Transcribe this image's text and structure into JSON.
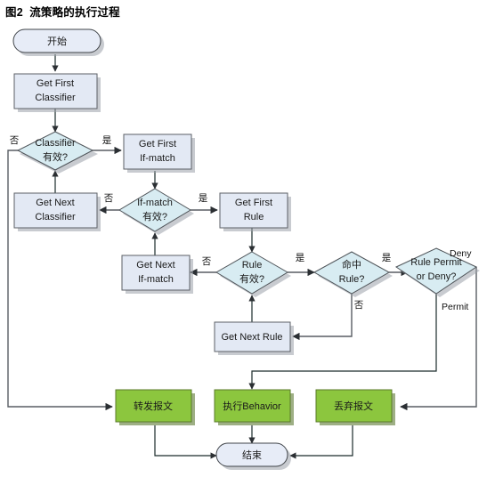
{
  "figure": {
    "title": "图2  流策略的执行过程",
    "caption_label": "图2",
    "caption_text": "流策略的执行过程"
  },
  "colors": {
    "process_fill": "#e3e9f4",
    "decision_fill": "#d8ecf2",
    "action_fill": "#8cc63e",
    "terminator_fill": "#e7ecf7",
    "line": "#595d63",
    "text": "#1a1a1a"
  },
  "nodes": {
    "start": {
      "label": "开始",
      "type": "terminator"
    },
    "get_first_classifier": {
      "label_line1": "Get First",
      "label_line2": "Classifier",
      "type": "process"
    },
    "classifier_valid": {
      "label_line1": "Classifier",
      "label_line2": "有效?",
      "type": "decision"
    },
    "get_next_classifier": {
      "label_line1": "Get Next",
      "label_line2": "Classifier",
      "type": "process"
    },
    "get_first_ifmatch": {
      "label_line1": "Get First",
      "label_line2": "If-match",
      "type": "process"
    },
    "ifmatch_valid": {
      "label_line1": "If-match",
      "label_line2": "有效?",
      "type": "decision"
    },
    "get_next_ifmatch": {
      "label_line1": "Get Next",
      "label_line2": "If-match",
      "type": "process"
    },
    "get_first_rule": {
      "label_line1": "Get First",
      "label_line2": "Rule",
      "type": "process"
    },
    "rule_valid": {
      "label_line1": "Rule",
      "label_line2": "有效?",
      "type": "decision"
    },
    "get_next_rule": {
      "label_line1": "Get Next Rule",
      "label_line2": "",
      "type": "process"
    },
    "hit_rule": {
      "label_line1": "命中",
      "label_line2": "Rule?",
      "type": "decision"
    },
    "permit_or_deny": {
      "label_line1": "Rule Permit",
      "label_line2": "or Deny?",
      "type": "decision"
    },
    "forward_packet": {
      "label": "转发报文",
      "type": "action"
    },
    "execute_behavior": {
      "label": "执行Behavior",
      "type": "action"
    },
    "discard_packet": {
      "label": "丢弃报文",
      "type": "action"
    },
    "end": {
      "label": "结束",
      "type": "terminator"
    }
  },
  "edge_labels": {
    "classifier_no": "否",
    "classifier_yes": "是",
    "ifmatch_no": "否",
    "ifmatch_yes": "是",
    "rule_no": "否",
    "rule_yes": "是",
    "hit_rule_yes": "是",
    "hit_rule_no": "否",
    "deny": "Deny",
    "permit": "Permit"
  }
}
